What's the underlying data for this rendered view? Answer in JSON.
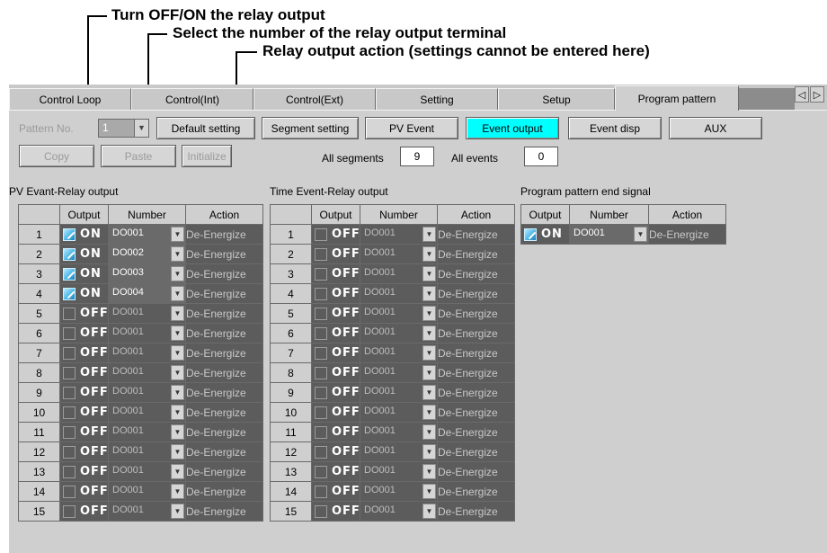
{
  "callouts": {
    "output": "Turn OFF/ON the relay output",
    "number": "Select the number of the relay output terminal",
    "action": "Relay output action (settings cannot be entered here)"
  },
  "tabs": [
    {
      "label": "Control Loop"
    },
    {
      "label": "Control(Int)"
    },
    {
      "label": "Control(Ext)"
    },
    {
      "label": "Setting"
    },
    {
      "label": "Setup"
    },
    {
      "label": "Program pattern"
    }
  ],
  "tab_arrows": {
    "left": "◁",
    "right": "▷"
  },
  "toolbar": {
    "pattern_no_label": "Pattern No.",
    "pattern_no_value": "1",
    "default_setting": "Default setting",
    "segment_setting": "Segment setting",
    "pv_event": "PV Event",
    "event_output": "Event output",
    "event_disp": "Event disp",
    "aux": "AUX",
    "copy": "Copy",
    "paste": "Paste",
    "initialize": "Initialize",
    "all_segments_label": "All segments",
    "all_segments_value": "9",
    "all_events_label": "All events",
    "all_events_value": "0"
  },
  "columns": {
    "output": "Output",
    "number": "Number",
    "action": "Action"
  },
  "pv_event": {
    "title": "PV Evant-Relay output",
    "rows": [
      {
        "n": "1",
        "on": true,
        "state": "ON",
        "number": "DO001",
        "action": "De-Energize"
      },
      {
        "n": "2",
        "on": true,
        "state": "ON",
        "number": "DO002",
        "action": "De-Energize"
      },
      {
        "n": "3",
        "on": true,
        "state": "ON",
        "number": "DO003",
        "action": "De-Energize"
      },
      {
        "n": "4",
        "on": true,
        "state": "ON",
        "number": "DO004",
        "action": "De-Energize"
      },
      {
        "n": "5",
        "on": false,
        "state": "OFF",
        "number": "DO001",
        "action": "De-Energize"
      },
      {
        "n": "6",
        "on": false,
        "state": "OFF",
        "number": "DO001",
        "action": "De-Energize"
      },
      {
        "n": "7",
        "on": false,
        "state": "OFF",
        "number": "DO001",
        "action": "De-Energize"
      },
      {
        "n": "8",
        "on": false,
        "state": "OFF",
        "number": "DO001",
        "action": "De-Energize"
      },
      {
        "n": "9",
        "on": false,
        "state": "OFF",
        "number": "DO001",
        "action": "De-Energize"
      },
      {
        "n": "10",
        "on": false,
        "state": "OFF",
        "number": "DO001",
        "action": "De-Energize"
      },
      {
        "n": "11",
        "on": false,
        "state": "OFF",
        "number": "DO001",
        "action": "De-Energize"
      },
      {
        "n": "12",
        "on": false,
        "state": "OFF",
        "number": "DO001",
        "action": "De-Energize"
      },
      {
        "n": "13",
        "on": false,
        "state": "OFF",
        "number": "DO001",
        "action": "De-Energize"
      },
      {
        "n": "14",
        "on": false,
        "state": "OFF",
        "number": "DO001",
        "action": "De-Energize"
      },
      {
        "n": "15",
        "on": false,
        "state": "OFF",
        "number": "DO001",
        "action": "De-Energize"
      }
    ]
  },
  "time_event": {
    "title": "Time Event-Relay output",
    "rows": [
      {
        "n": "1",
        "on": false,
        "state": "OFF",
        "number": "DO001",
        "action": "De-Energize"
      },
      {
        "n": "2",
        "on": false,
        "state": "OFF",
        "number": "DO001",
        "action": "De-Energize"
      },
      {
        "n": "3",
        "on": false,
        "state": "OFF",
        "number": "DO001",
        "action": "De-Energize"
      },
      {
        "n": "4",
        "on": false,
        "state": "OFF",
        "number": "DO001",
        "action": "De-Energize"
      },
      {
        "n": "5",
        "on": false,
        "state": "OFF",
        "number": "DO001",
        "action": "De-Energize"
      },
      {
        "n": "6",
        "on": false,
        "state": "OFF",
        "number": "DO001",
        "action": "De-Energize"
      },
      {
        "n": "7",
        "on": false,
        "state": "OFF",
        "number": "DO001",
        "action": "De-Energize"
      },
      {
        "n": "8",
        "on": false,
        "state": "OFF",
        "number": "DO001",
        "action": "De-Energize"
      },
      {
        "n": "9",
        "on": false,
        "state": "OFF",
        "number": "DO001",
        "action": "De-Energize"
      },
      {
        "n": "10",
        "on": false,
        "state": "OFF",
        "number": "DO001",
        "action": "De-Energize"
      },
      {
        "n": "11",
        "on": false,
        "state": "OFF",
        "number": "DO001",
        "action": "De-Energize"
      },
      {
        "n": "12",
        "on": false,
        "state": "OFF",
        "number": "DO001",
        "action": "De-Energize"
      },
      {
        "n": "13",
        "on": false,
        "state": "OFF",
        "number": "DO001",
        "action": "De-Energize"
      },
      {
        "n": "14",
        "on": false,
        "state": "OFF",
        "number": "DO001",
        "action": "De-Energize"
      },
      {
        "n": "15",
        "on": false,
        "state": "OFF",
        "number": "DO001",
        "action": "De-Energize"
      }
    ]
  },
  "end_signal": {
    "title": "Program pattern end signal",
    "row": {
      "on": true,
      "state": "ON",
      "number": "DO001",
      "action": "De-Energize"
    }
  },
  "colors": {
    "active_button": "#00ffff",
    "cell_background": "#5c5c5c",
    "panel": "#cfcfcf"
  }
}
